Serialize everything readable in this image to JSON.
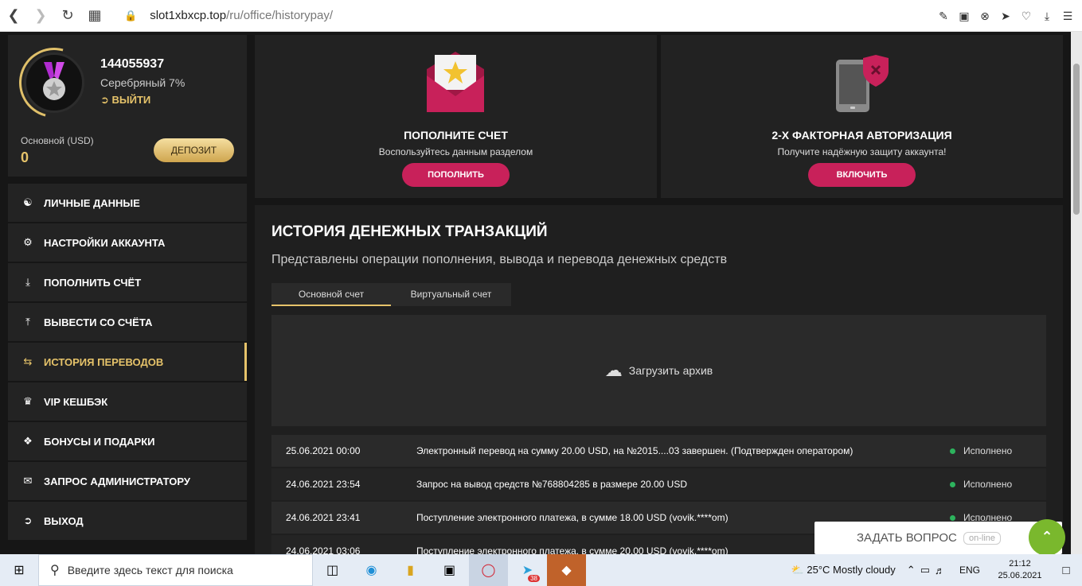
{
  "browser": {
    "url_host": "slot1xbxcp.top",
    "url_path": "/ru/office/historypay/"
  },
  "profile": {
    "user_id": "144055937",
    "level": "Серебряный 7%",
    "logout": "ВЫЙТИ",
    "balance_label": "Основной (USD)",
    "balance_value": "0",
    "deposit_button": "ДЕПОЗИТ"
  },
  "menu": {
    "items": [
      {
        "label": "ЛИЧНЫЕ ДАННЫЕ",
        "icon": "user-add-icon"
      },
      {
        "label": "НАСТРОЙКИ АККАУНТА",
        "icon": "gears-icon"
      },
      {
        "label": "ПОПОЛНИТЬ СЧЁТ",
        "icon": "download-icon"
      },
      {
        "label": "ВЫВЕСТИ СО СЧЁТА",
        "icon": "upload-icon"
      },
      {
        "label": "ИСТОРИЯ ПЕРЕВОДОВ",
        "icon": "transfer-icon"
      },
      {
        "label": "VIP КЕШБЭК",
        "icon": "crown-icon"
      },
      {
        "label": "БОНУСЫ И ПОДАРКИ",
        "icon": "gift-icon"
      },
      {
        "label": "ЗАПРОС АДМИНИСТРАТОРУ",
        "icon": "envelope-icon"
      },
      {
        "label": "ВЫХОД",
        "icon": "exit-icon"
      }
    ],
    "active_index": 4,
    "accent_color": "#e6c36a"
  },
  "cards": {
    "deposit": {
      "title": "ПОПОЛНИТЕ СЧЕТ",
      "subtitle": "Воспользуйтесь данным разделом",
      "button": "ПОПОЛНИТЬ"
    },
    "twofa": {
      "title": "2-Х ФАКТОРНАЯ АВТОРИЗАЦИЯ",
      "subtitle": "Получите надёжную защиту аккаунта!",
      "button": "ВКЛЮЧИТЬ"
    },
    "button_color": "#c8215a"
  },
  "history": {
    "title": "ИСТОРИЯ ДЕНЕЖНЫХ ТРАНЗАКЦИЙ",
    "subtitle": "Представлены операции пополнения, вывода и перевода денежных средств",
    "tabs": [
      "Основной счет",
      "Виртуальный счет"
    ],
    "archive_label": "Загрузить архив",
    "rows": [
      {
        "date": "25.06.2021 00:00",
        "desc": "Электронный перевод на сумму 20.00 USD, на №2015....03 завершен. (Подтвержден оператором)",
        "status": "Исполнено"
      },
      {
        "date": "24.06.2021 23:54",
        "desc": "Запрос на вывод средств №768804285 в размере 20.00 USD",
        "status": "Исполнено"
      },
      {
        "date": "24.06.2021 23:41",
        "desc": "Поступление электронного платежа, в сумме 18.00 USD (vovik.****om)",
        "status": "Исполнено"
      },
      {
        "date": "24.06.2021 03:06",
        "desc": "Поступление электронного платежа, в сумме 20.00 USD (vovik.****om)",
        "status": ""
      }
    ]
  },
  "chat": {
    "label": "ЗАДАТЬ ВОПРОС",
    "badge": "on-line"
  },
  "taskbar": {
    "search_placeholder": "Введите здесь текст для поиска",
    "weather": "25°C  Mostly cloudy",
    "lang": "ENG",
    "time": "21:12",
    "date": "25.06.2021",
    "telegram_badge": "38"
  }
}
